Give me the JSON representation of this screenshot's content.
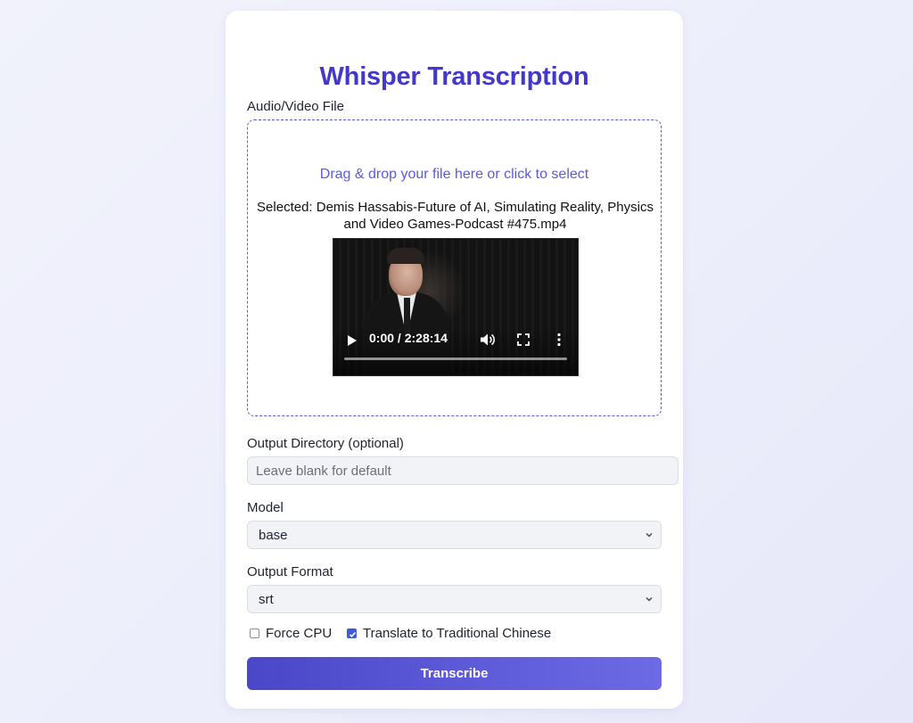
{
  "header": {
    "title": "Whisper Transcription"
  },
  "file_section": {
    "label": "Audio/Video File",
    "drop_hint": "Drag & drop your file here or click to select",
    "selected_text": "Selected: Demis Hassabis-Future of AI, Simulating Reality, Physics and Video Games-Podcast #475.mp4",
    "video": {
      "current_time": "0:00",
      "duration": "2:28:14",
      "progress": 0
    }
  },
  "output_directory": {
    "label": "Output Directory (optional)",
    "value": "",
    "placeholder": "Leave blank for default"
  },
  "model": {
    "label": "Model",
    "selected": "base"
  },
  "output_format": {
    "label": "Output Format",
    "selected": "srt"
  },
  "options": {
    "force_cpu": {
      "label": "Force CPU",
      "checked": false
    },
    "translate": {
      "label": "Translate to Traditional Chinese",
      "checked": true
    }
  },
  "actions": {
    "transcribe_label": "Transcribe"
  },
  "colors": {
    "accent": "#4338ca",
    "dropzone_border": "#5b5bd6",
    "checkbox_checked": "#3b5bdb",
    "button_gradient_start": "#4a47c8",
    "button_gradient_end": "#6c6ae4"
  },
  "icons": {
    "play": "play-icon",
    "volume": "volume-icon",
    "fullscreen": "fullscreen-icon",
    "more": "more-vertical-icon",
    "select_chevron": "chevron-down-icon",
    "checkmark": "checkmark-icon"
  }
}
